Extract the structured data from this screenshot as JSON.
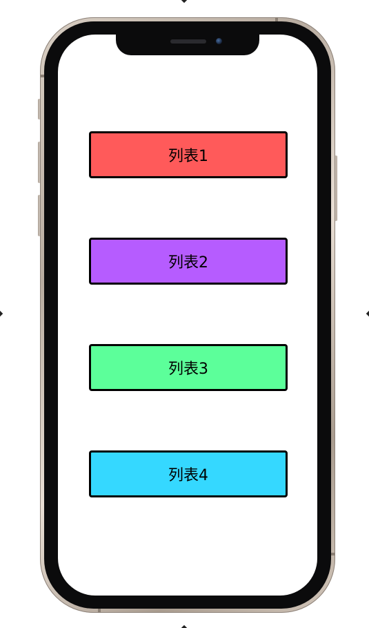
{
  "list": {
    "items": [
      {
        "label": "列表1",
        "color": "#ff5a5a"
      },
      {
        "label": "列表2",
        "color": "#b65cff"
      },
      {
        "label": "列表3",
        "color": "#5cff9a"
      },
      {
        "label": "列表4",
        "color": "#35d8ff"
      }
    ]
  },
  "device": {
    "frame_color": "#d9cfc4",
    "bezel_color": "#0b0b0c",
    "screen_color": "#ffffff"
  }
}
